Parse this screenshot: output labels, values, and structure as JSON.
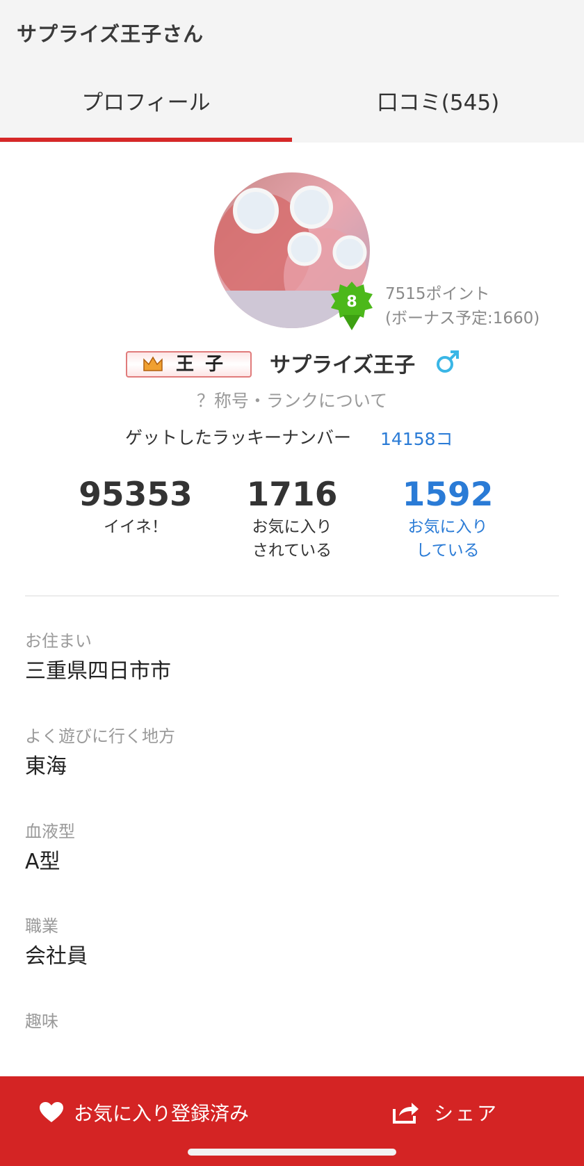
{
  "header": {
    "title": "サプライズ王子さん"
  },
  "tabs": [
    {
      "label": "プロフィール",
      "active": true
    },
    {
      "label": "口コミ(545)",
      "active": false
    }
  ],
  "profile": {
    "level": "8",
    "points": "7515ポイント",
    "bonus": "(ボーナス予定:1660)",
    "rank_badge": "王子",
    "username": "サプライズ王子",
    "gender_icon": "male-icon",
    "rank_link": "？称号・ランクについて",
    "lucky_label": "ゲットしたラッキーナンバー",
    "lucky_value": "14158コ"
  },
  "stats": [
    {
      "value": "95353",
      "label": "イイネ！"
    },
    {
      "value": "1716",
      "label": "お気に入り\nされている"
    },
    {
      "value": "1592",
      "label": "お気に入り\nしている"
    }
  ],
  "fields": [
    {
      "label": "お住まい",
      "value": "三重県四日市市"
    },
    {
      "label": "よく遊びに行く地方",
      "value": "東海"
    },
    {
      "label": "血液型",
      "value": "A型"
    },
    {
      "label": "職業",
      "value": "会社員"
    },
    {
      "label": "趣味",
      "value": ""
    }
  ],
  "bottom_bar": {
    "favorite_label": "お気に入り登録済み",
    "share_label": "シェア"
  },
  "colors": {
    "accent_red": "#d42424",
    "link_blue": "#2a7bd6",
    "level_green": "#4cb81a"
  }
}
